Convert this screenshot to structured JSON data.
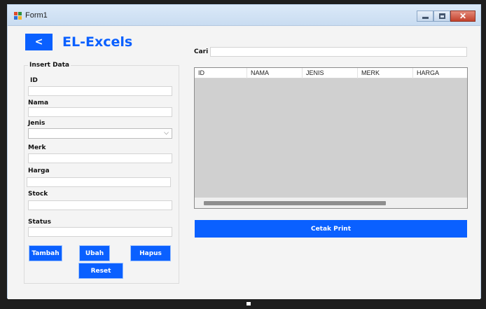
{
  "window": {
    "title": "Form1"
  },
  "header": {
    "back_label": "<",
    "brand": "EL-Excels"
  },
  "insert": {
    "title": "Insert Data",
    "fields": {
      "id": {
        "label": "ID",
        "value": ""
      },
      "nama": {
        "label": "Nama",
        "value": ""
      },
      "jenis": {
        "label": "Jenis",
        "value": ""
      },
      "merk": {
        "label": "Merk",
        "value": ""
      },
      "harga": {
        "label": "Harga",
        "value": ""
      },
      "stock": {
        "label": "Stock",
        "value": ""
      },
      "status": {
        "label": "Status",
        "value": ""
      }
    },
    "buttons": {
      "tambah": "Tambah",
      "ubah": "Ubah",
      "hapus": "Hapus",
      "reset": "Reset"
    }
  },
  "search": {
    "label": "Cari",
    "value": ""
  },
  "table": {
    "columns": [
      "ID",
      "NAMA",
      "JENIS",
      "MERK",
      "HARGA"
    ],
    "rows": []
  },
  "print": {
    "label": "Cetak Print"
  },
  "colors": {
    "accent": "#0a60ff",
    "grid_bg": "#d0d0d0",
    "window_bg": "#f4f4f4"
  },
  "icons": {
    "app": "form-app-icon",
    "select": "chevron-down-icon"
  }
}
